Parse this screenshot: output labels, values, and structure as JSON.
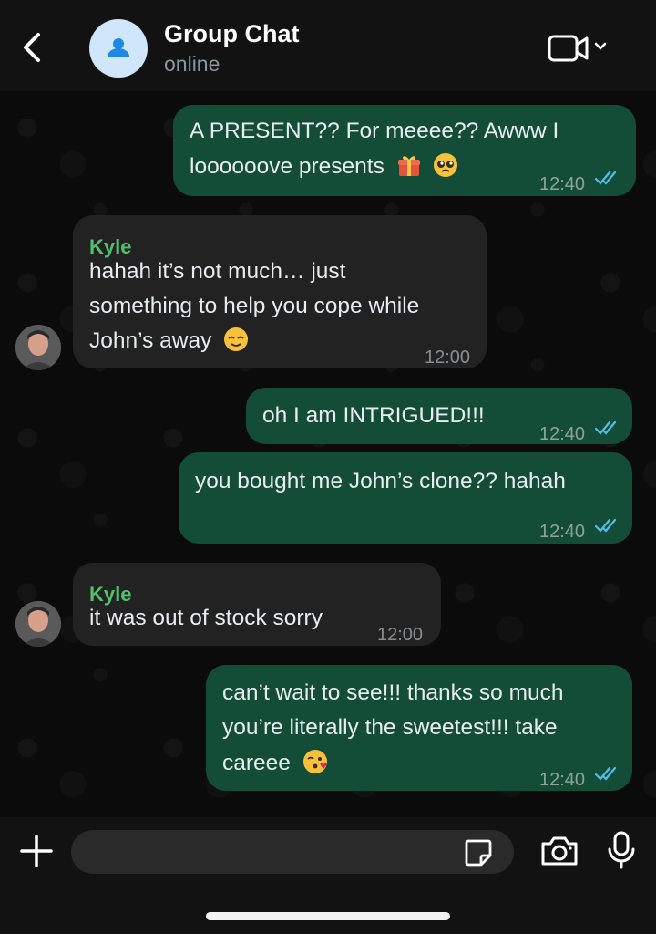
{
  "header": {
    "title": "Group Chat",
    "status": "online",
    "icons": [
      "chevron-left-icon",
      "group-avatar-icon",
      "video-call-icon",
      "chevron-down-icon"
    ]
  },
  "messages": [
    {
      "direction": "outgoing",
      "lines": [
        "A PRESENT?? For meeee?? Awww I",
        "loooooove presents"
      ],
      "emoji": [
        "gift",
        "pleading-face"
      ],
      "time": "12:40",
      "read": true
    },
    {
      "direction": "incoming",
      "sender": "Kyle",
      "lines": [
        "hahah it’s not much… just",
        "something to help you cope while",
        "John’s away"
      ],
      "emoji": [
        "relieved-face"
      ],
      "time": "12:00"
    },
    {
      "direction": "outgoing",
      "lines": [
        "oh I am INTRIGUED!!!"
      ],
      "time": "12:40",
      "read": true
    },
    {
      "direction": "outgoing",
      "lines": [
        "you bought me John’s clone?? hahah"
      ],
      "time": "12:40",
      "read": true
    },
    {
      "direction": "incoming",
      "sender": "Kyle",
      "lines": [
        "it was out of stock sorry"
      ],
      "time": "12:00"
    },
    {
      "direction": "outgoing",
      "lines": [
        "can’t wait to see!!! thanks so much",
        "you’re literally the sweetest!!! take",
        "careee"
      ],
      "emoji": [
        "face-blowing-kiss"
      ],
      "time": "12:40",
      "read": true
    }
  ],
  "composer": {
    "input_value": "",
    "icons": [
      "plus-icon",
      "sticker-icon",
      "camera-icon",
      "microphone-icon"
    ]
  },
  "colors": {
    "outgoing_bubble": "#134d37",
    "incoming_bubble": "#222222",
    "sender_name": "#51c26b",
    "read_ticks": "#53bdeb",
    "background": "#0b0b0b"
  }
}
